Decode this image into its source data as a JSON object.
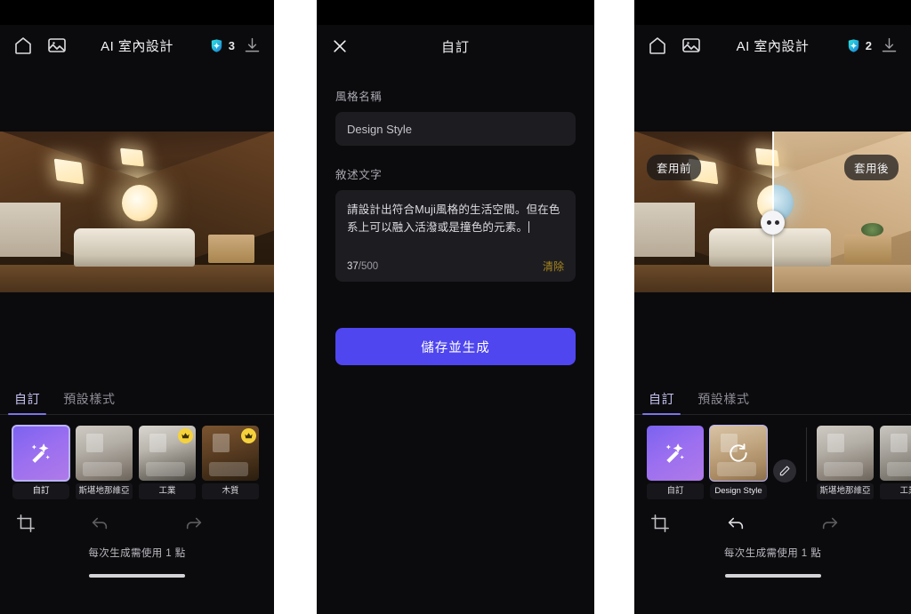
{
  "app": {
    "title": "AI 室內設計",
    "icons": {
      "home": "home-icon",
      "gallery": "gallery-icon",
      "download": "download-icon"
    }
  },
  "panel1": {
    "credits": "3",
    "tabs": [
      {
        "label": "自訂",
        "active": true
      },
      {
        "label": "預設樣式",
        "active": false
      }
    ],
    "styles": [
      {
        "label": "自訂",
        "type": "magic",
        "selected": true,
        "premium": false
      },
      {
        "label": "斯堪地那維亞",
        "type": "room1",
        "selected": false,
        "premium": false
      },
      {
        "label": "工業",
        "type": "room2",
        "selected": false,
        "premium": true
      },
      {
        "label": "木質",
        "type": "room3",
        "selected": false,
        "premium": true
      }
    ],
    "bottom": {
      "crop_icon": "crop-icon",
      "undo_icon": "undo-icon",
      "redo_icon": "redo-icon",
      "hint": "每次生成需使用 1 點"
    }
  },
  "sheet": {
    "title": "自訂",
    "close_icon": "close-icon",
    "name_label": "風格名稱",
    "name_value": "Design Style",
    "desc_label": "敘述文字",
    "desc_value": "請設計出符合Muji風格的生活空間。但在色系上可以融入活潑或是撞色的元素。",
    "counter_current": "37",
    "counter_max": "/500",
    "clear_label": "清除",
    "submit_label": "儲存並生成",
    "accent": "#4f46ef",
    "clear_color": "#a8861f"
  },
  "panel3": {
    "credits": "2",
    "before_tag": "套用前",
    "after_tag": "套用後",
    "slider_handle": "compare-slider-handle",
    "tabs": [
      {
        "label": "自訂",
        "active": true
      },
      {
        "label": "預設樣式",
        "active": false
      }
    ],
    "styles": [
      {
        "label": "自訂",
        "type": "magic",
        "selected": false,
        "premium": false
      },
      {
        "label": "Design Style",
        "type": "muji",
        "selected": true,
        "premium": false,
        "overlay_icon": "refresh-icon"
      },
      {
        "label": "斯堪地那維亞",
        "type": "room1",
        "selected": false,
        "premium": false
      },
      {
        "label": "工業",
        "type": "room2",
        "selected": false,
        "premium": false
      }
    ],
    "edit_icon": "pencil-icon",
    "bottom": {
      "crop_icon": "crop-icon",
      "undo_icon": "undo-icon",
      "redo_icon": "redo-icon",
      "hint": "每次生成需使用 1 點"
    }
  }
}
